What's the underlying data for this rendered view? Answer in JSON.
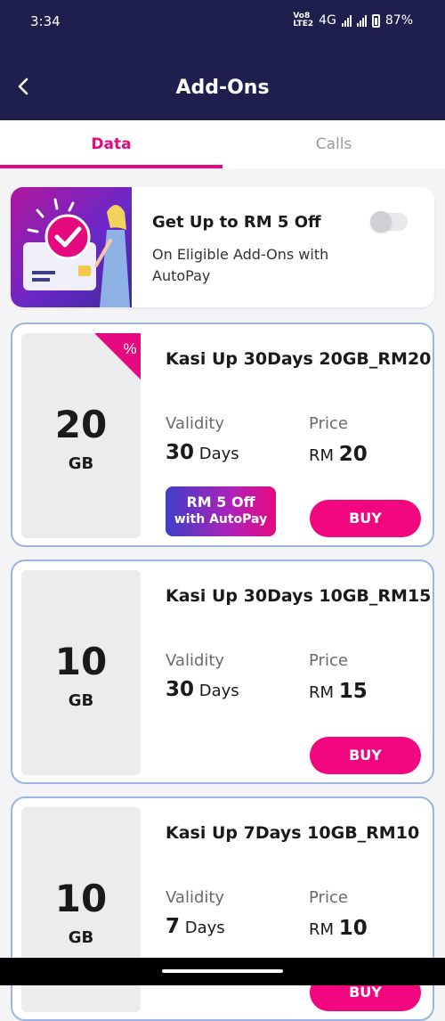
{
  "status_bar": {
    "time": "3:34",
    "network_top": "Vo8",
    "network_bottom": "LTE2",
    "network_type": "4G",
    "battery": "87%"
  },
  "header": {
    "title": "Add-Ons",
    "back_icon": "chevron-left-icon"
  },
  "tabs": [
    {
      "label": "Data",
      "active": true
    },
    {
      "label": "Calls",
      "active": false
    }
  ],
  "promo": {
    "title": "Get Up to RM 5 Off",
    "subtitle": "On Eligible Add-Ons with AutoPay",
    "autopay_enabled": false
  },
  "plans": [
    {
      "size": "20",
      "unit": "GB",
      "name": "Kasi Up 30Days 20GB_RM20",
      "validity_label": "Validity",
      "validity_value": "30",
      "validity_unit": "Days",
      "price_label": "Price",
      "price_currency": "RM",
      "price_value": "20",
      "discount_badge": "%",
      "autopay_line1": "RM 5 Off",
      "autopay_line2": "with AutoPay",
      "buy_label": "BUY"
    },
    {
      "size": "10",
      "unit": "GB",
      "name": "Kasi Up 30Days 10GB_RM15",
      "validity_label": "Validity",
      "validity_value": "30",
      "validity_unit": "Days",
      "price_label": "Price",
      "price_currency": "RM",
      "price_value": "15",
      "buy_label": "BUY"
    },
    {
      "size": "10",
      "unit": "GB",
      "name": "Kasi Up 7Days 10GB_RM10",
      "validity_label": "Validity",
      "validity_value": "7",
      "validity_unit": "Days",
      "price_label": "Price",
      "price_currency": "RM",
      "price_value": "10",
      "buy_label": "BUY"
    }
  ],
  "colors": {
    "header_bg": "#1f1f4e",
    "accent": "#e5097f",
    "card_border": "#9bb4e0"
  }
}
